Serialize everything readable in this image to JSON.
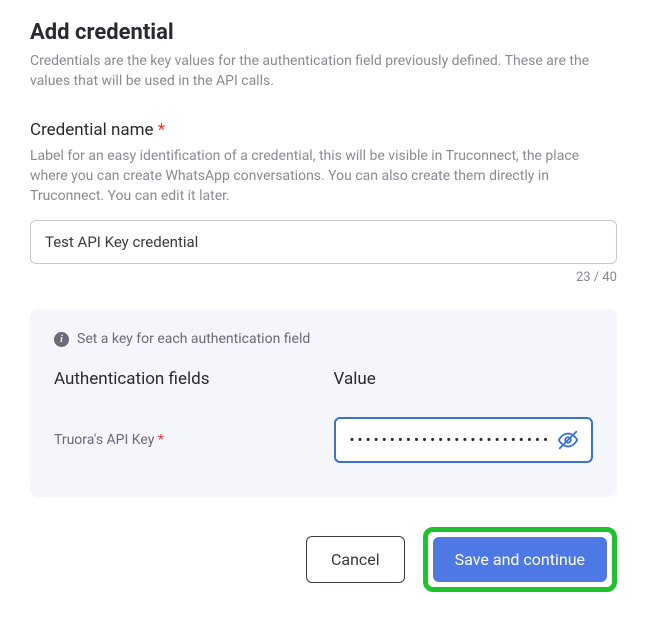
{
  "header": {
    "title": "Add credential",
    "subtitle": "Credentials are the key values for the authentication field previously defined. These are the values that will be used in the API calls."
  },
  "credentialName": {
    "label": "Credential name",
    "required": "*",
    "help": "Label for an easy identification of a credential, this will be visible in Truconnect, the place where you can create WhatsApp conversations. You can also create them directly in Truconnect. You can edit it later.",
    "value": "Test API Key credential",
    "counter": "23 / 40"
  },
  "panel": {
    "hint": "Set a key for each authentication field",
    "headers": {
      "field": "Authentication fields",
      "value": "Value"
    },
    "rows": [
      {
        "label": "Truora's API Key",
        "required": "*",
        "value": "•••••••••••••••••••••••••••••"
      }
    ]
  },
  "actions": {
    "cancel": "Cancel",
    "save": "Save and continue"
  }
}
